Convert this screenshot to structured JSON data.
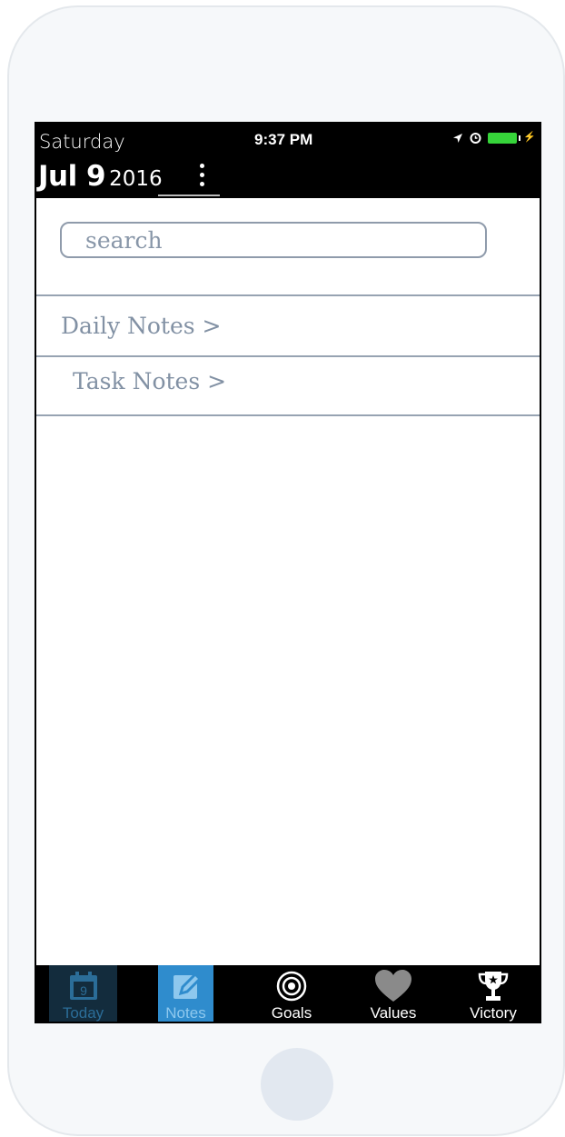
{
  "colors": {
    "header_bg": "#000000",
    "divider": "#97a3b2",
    "text_muted": "#8291a4",
    "tab_active_bg": "#2f8ccd",
    "tab_today_bg": "#132c3d",
    "battery": "#36d43a"
  },
  "status_bar": {
    "time": "9:37 PM",
    "icons": [
      "location-arrow-icon",
      "alarm-clock-icon",
      "battery-charging-icon"
    ]
  },
  "header": {
    "day_name": "Saturday",
    "date_main": "Jul 9",
    "year": "2016",
    "menu_icon": "vertical-ellipsis-icon"
  },
  "search": {
    "placeholder": "search",
    "value": ""
  },
  "notes_list": [
    {
      "label": "Daily Notes >"
    },
    {
      "label": "Task Notes >"
    }
  ],
  "tab_bar": {
    "active": "Notes",
    "tabs": [
      {
        "label": "Today",
        "icon": "calendar-icon",
        "icon_text": "9"
      },
      {
        "label": "Notes",
        "icon": "pencil-icon"
      },
      {
        "label": "Goals",
        "icon": "target-icon"
      },
      {
        "label": "Values",
        "icon": "heart-icon"
      },
      {
        "label": "Victory",
        "icon": "trophy-icon"
      }
    ]
  }
}
